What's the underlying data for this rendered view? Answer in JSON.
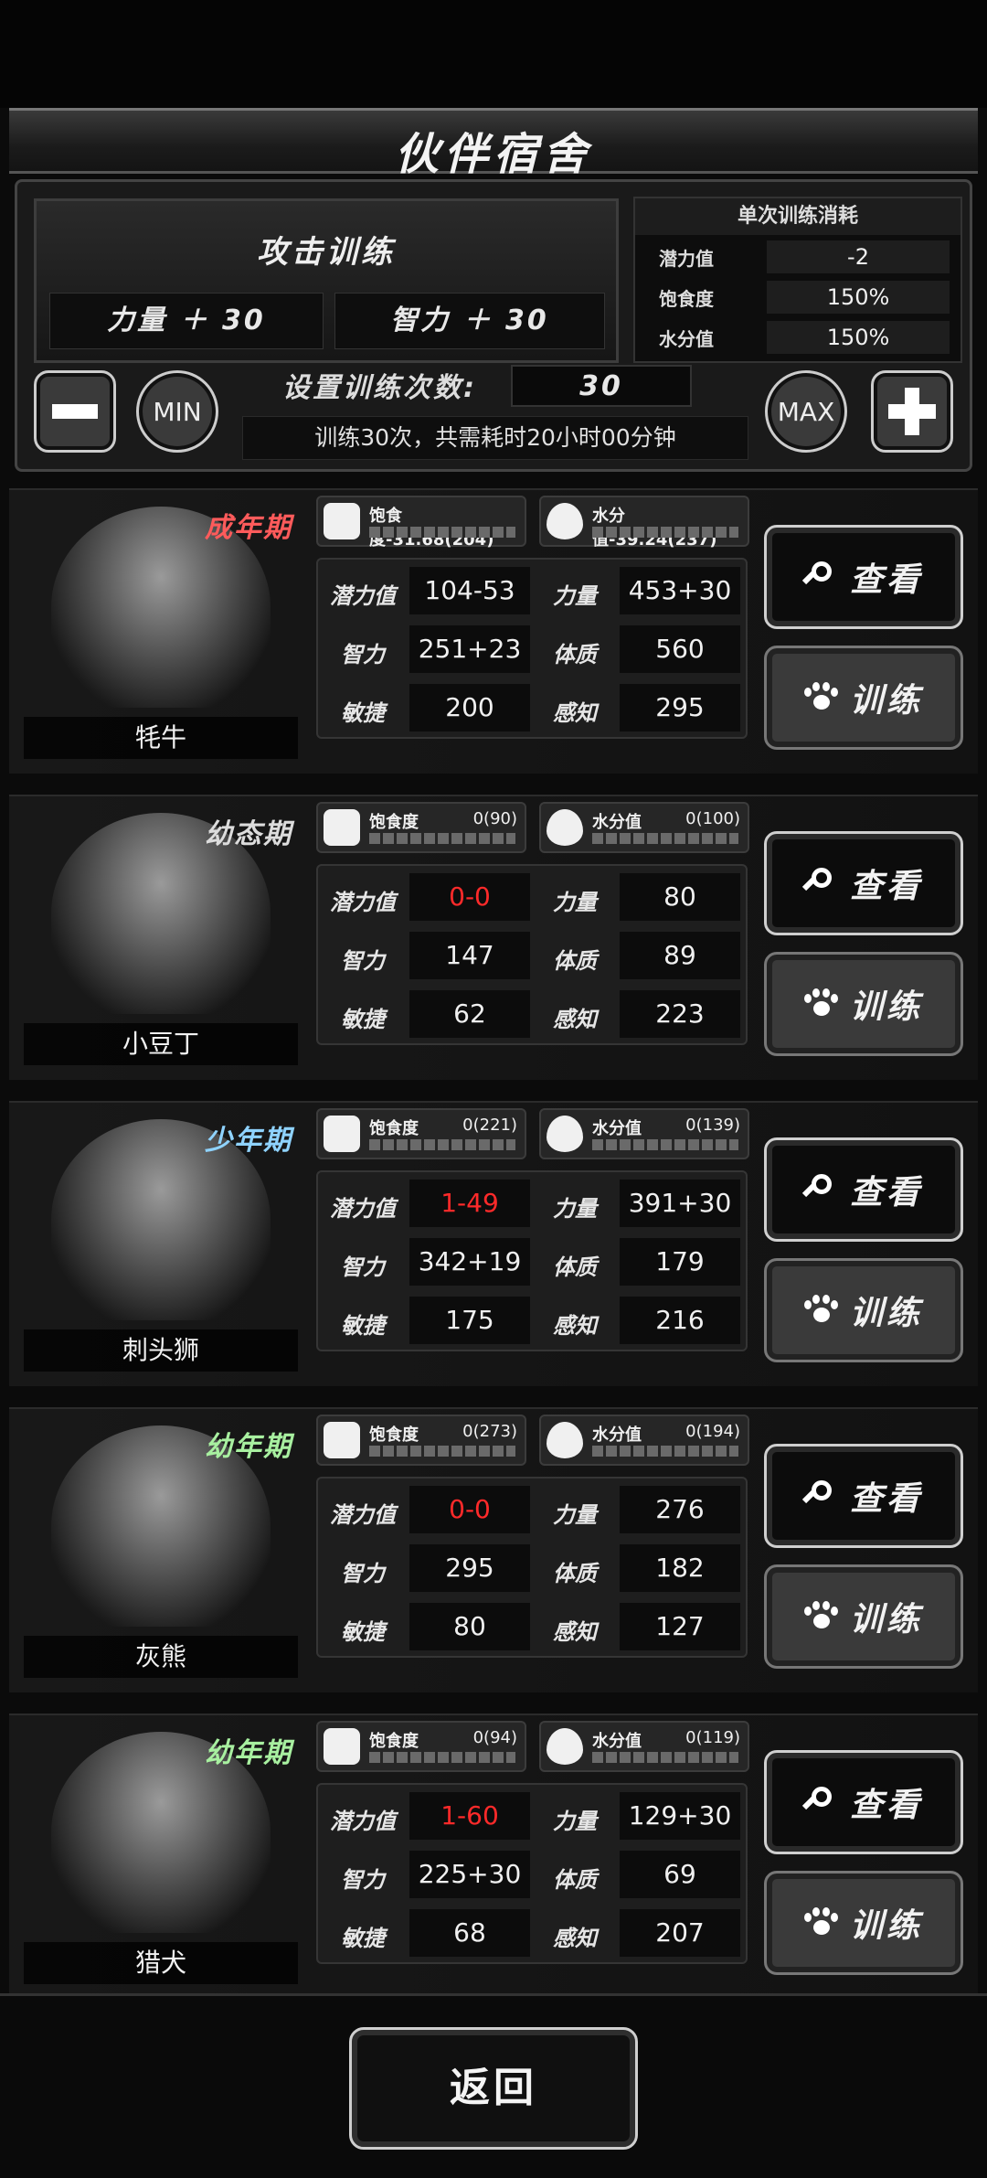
{
  "header": {
    "title": "伙伴宿舍"
  },
  "training": {
    "name": "攻击训练",
    "bonus_strength": "力量 ＋ 30",
    "bonus_intellect": "智力 ＋ 30",
    "cost_title": "单次训练消耗",
    "costs": [
      {
        "label": "潜力值",
        "value": "-2"
      },
      {
        "label": "饱食度",
        "value": "150%"
      },
      {
        "label": "水分值",
        "value": "150%"
      }
    ],
    "minus_icon": "minus-icon",
    "min_label": "MIN",
    "count_label": "设置训练次数:",
    "count_value": "30",
    "info": "训练30次，共需耗时20小时00分钟",
    "max_label": "MAX",
    "plus_icon": "plus-icon"
  },
  "labels": {
    "satiety": "饱食度",
    "water": "水分值",
    "potential": "潜力值",
    "strength": "力量",
    "intellect": "智力",
    "constitution": "体质",
    "agility": "敏捷",
    "perception": "感知",
    "view": "查看",
    "train": "训练"
  },
  "companions": [
    {
      "name": "牦牛",
      "stage": "成年期",
      "stage_color": "#ff5b5b",
      "satiety_label": "饱食度-31.68(204)",
      "satiety_value": "",
      "water_label": "水分值-39.24(237)",
      "water_value": "",
      "potential": "104-53",
      "potential_red": false,
      "strength": "453+30",
      "intellect": "251+23",
      "constitution": "560",
      "agility": "200",
      "perception": "295"
    },
    {
      "name": "小豆丁",
      "stage": "幼态期",
      "stage_color": "#dcdcdc",
      "satiety_label": "饱食度",
      "satiety_value": "0(90)",
      "water_label": "水分值",
      "water_value": "0(100)",
      "potential": "0-0",
      "potential_red": true,
      "strength": "80",
      "intellect": "147",
      "constitution": "89",
      "agility": "62",
      "perception": "223"
    },
    {
      "name": "刺头狮",
      "stage": "少年期",
      "stage_color": "#8fd3ff",
      "satiety_label": "饱食度",
      "satiety_value": "0(221)",
      "water_label": "水分值",
      "water_value": "0(139)",
      "potential": "1-49",
      "potential_red": true,
      "strength": "391+30",
      "intellect": "342+19",
      "constitution": "179",
      "agility": "175",
      "perception": "216"
    },
    {
      "name": "灰熊",
      "stage": "幼年期",
      "stage_color": "#a8f0a0",
      "satiety_label": "饱食度",
      "satiety_value": "0(273)",
      "water_label": "水分值",
      "water_value": "0(194)",
      "potential": "0-0",
      "potential_red": true,
      "strength": "276",
      "intellect": "295",
      "constitution": "182",
      "agility": "80",
      "perception": "127"
    },
    {
      "name": "猎犬",
      "stage": "幼年期",
      "stage_color": "#a8f0a0",
      "satiety_label": "饱食度",
      "satiety_value": "0(94)",
      "water_label": "水分值",
      "water_value": "0(119)",
      "potential": "1-60",
      "potential_red": true,
      "strength": "129+30",
      "intellect": "225+30",
      "constitution": "69",
      "agility": "68",
      "perception": "207"
    }
  ],
  "footer": {
    "back_label": "返回"
  }
}
